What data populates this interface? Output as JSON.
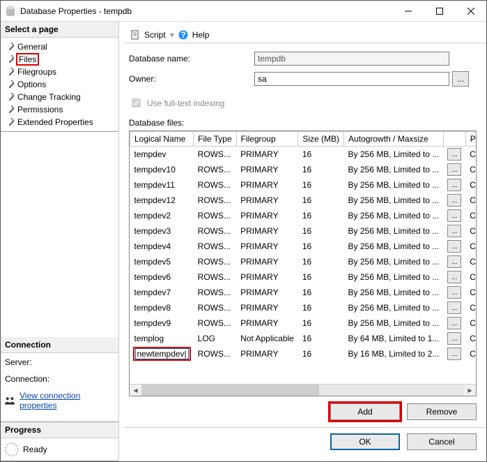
{
  "window": {
    "title": "Database Properties - tempdb"
  },
  "sidebar": {
    "pages_header": "Select a page",
    "pages": [
      {
        "label": "General",
        "selected": false
      },
      {
        "label": "Files",
        "selected": true
      },
      {
        "label": "Filegroups",
        "selected": false
      },
      {
        "label": "Options",
        "selected": false
      },
      {
        "label": "Change Tracking",
        "selected": false
      },
      {
        "label": "Permissions",
        "selected": false
      },
      {
        "label": "Extended Properties",
        "selected": false
      }
    ],
    "connection_header": "Connection",
    "server_label": "Server:",
    "server_value": "",
    "connection_label": "Connection:",
    "connection_value": "",
    "view_conn_link": "View connection properties",
    "progress_header": "Progress",
    "progress_status": "Ready"
  },
  "toolbar": {
    "script": "Script",
    "help": "Help"
  },
  "form": {
    "dbname_label": "Database name:",
    "dbname_value": "tempdb",
    "owner_label": "Owner:",
    "owner_value": "sa",
    "fulltext_label": "Use full-text indexing"
  },
  "grid": {
    "label": "Database files:",
    "headers": {
      "logical": "Logical Name",
      "filetype": "File Type",
      "filegroup": "Filegroup",
      "size": "Size (MB)",
      "autogrowth": "Autogrowth / Maxsize",
      "path": "Path"
    },
    "rows": [
      {
        "ln": "tempdev",
        "ft": "ROWS...",
        "fg": "PRIMARY",
        "sz": "16",
        "ag": "By 256 MB, Limited to ...",
        "pth": "C:\\"
      },
      {
        "ln": "tempdev10",
        "ft": "ROWS...",
        "fg": "PRIMARY",
        "sz": "16",
        "ag": "By 256 MB, Limited to ...",
        "pth": "C:\\"
      },
      {
        "ln": "tempdev11",
        "ft": "ROWS...",
        "fg": "PRIMARY",
        "sz": "16",
        "ag": "By 256 MB, Limited to ...",
        "pth": "C:\\"
      },
      {
        "ln": "tempdev12",
        "ft": "ROWS...",
        "fg": "PRIMARY",
        "sz": "16",
        "ag": "By 256 MB, Limited to ...",
        "pth": "C:\\"
      },
      {
        "ln": "tempdev2",
        "ft": "ROWS...",
        "fg": "PRIMARY",
        "sz": "16",
        "ag": "By 256 MB, Limited to ...",
        "pth": "C:\\"
      },
      {
        "ln": "tempdev3",
        "ft": "ROWS...",
        "fg": "PRIMARY",
        "sz": "16",
        "ag": "By 256 MB, Limited to ...",
        "pth": "C:\\"
      },
      {
        "ln": "tempdev4",
        "ft": "ROWS...",
        "fg": "PRIMARY",
        "sz": "16",
        "ag": "By 256 MB, Limited to ...",
        "pth": "C:\\"
      },
      {
        "ln": "tempdev5",
        "ft": "ROWS...",
        "fg": "PRIMARY",
        "sz": "16",
        "ag": "By 256 MB, Limited to ...",
        "pth": "C:\\"
      },
      {
        "ln": "tempdev6",
        "ft": "ROWS...",
        "fg": "PRIMARY",
        "sz": "16",
        "ag": "By 256 MB, Limited to ...",
        "pth": "C:\\"
      },
      {
        "ln": "tempdev7",
        "ft": "ROWS...",
        "fg": "PRIMARY",
        "sz": "16",
        "ag": "By 256 MB, Limited to ...",
        "pth": "C:\\"
      },
      {
        "ln": "tempdev8",
        "ft": "ROWS...",
        "fg": "PRIMARY",
        "sz": "16",
        "ag": "By 256 MB, Limited to ...",
        "pth": "C:\\"
      },
      {
        "ln": "tempdev9",
        "ft": "ROWS...",
        "fg": "PRIMARY",
        "sz": "16",
        "ag": "By 256 MB, Limited to ...",
        "pth": "C:\\"
      },
      {
        "ln": "templog",
        "ft": "LOG",
        "fg": "Not Applicable",
        "sz": "16",
        "ag": "By 64 MB, Limited to 1...",
        "pth": "C:\\"
      },
      {
        "ln": "newtempdev",
        "ft": "ROWS...",
        "fg": "PRIMARY",
        "sz": "16",
        "ag": "By 16 MB, Limited to 2...",
        "pth": "C:\\",
        "editing": true
      }
    ],
    "add": "Add",
    "remove": "Remove"
  },
  "footer": {
    "ok": "OK",
    "cancel": "Cancel"
  }
}
